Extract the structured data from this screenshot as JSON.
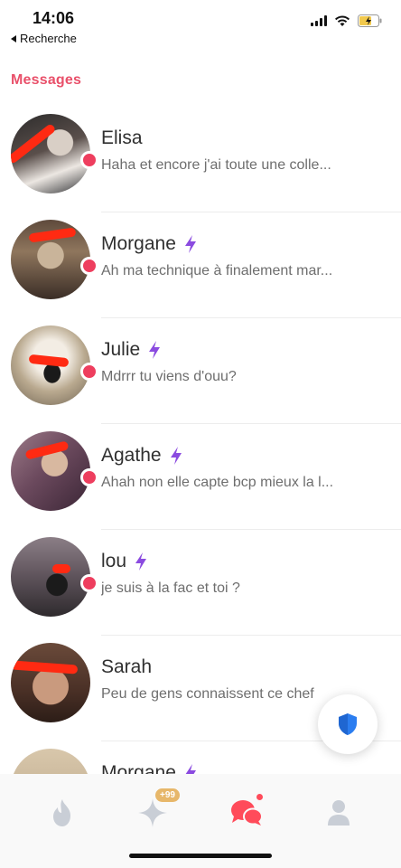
{
  "status_bar": {
    "time": "14:06",
    "back_label": "Recherche",
    "icons": [
      "signal-icon",
      "wifi-icon",
      "battery-charging-icon"
    ]
  },
  "section_title": "Messages",
  "colors": {
    "accent": "#e9506a",
    "unread": "#ee3e5e",
    "bolt": "#8b4be0",
    "shield": "#2b7df0",
    "badge": "#e7b76a"
  },
  "conversations": [
    {
      "name": "Elisa",
      "preview": "Haha et encore j'ai toute une colle...",
      "unread": true,
      "boosted": false
    },
    {
      "name": "Morgane",
      "preview": "Ah ma technique à finalement mar...",
      "unread": true,
      "boosted": true
    },
    {
      "name": "Julie",
      "preview": "Mdrrr tu viens d'ouu?",
      "unread": true,
      "boosted": true
    },
    {
      "name": "Agathe",
      "preview": "Ahah non elle capte bcp mieux la l...",
      "unread": true,
      "boosted": true
    },
    {
      "name": "lou",
      "preview": "je suis à la fac et toi ?",
      "unread": true,
      "boosted": true
    },
    {
      "name": "Sarah",
      "preview": "Peu de gens connaissent ce chef",
      "unread": false,
      "boosted": false
    },
    {
      "name": "Morgane",
      "preview": "",
      "unread": false,
      "boosted": true
    }
  ],
  "bottom_nav": {
    "items": [
      "flame-icon",
      "sparkle-icon",
      "chat-bubbles-icon",
      "profile-icon"
    ],
    "sparkle_badge": "+99"
  }
}
